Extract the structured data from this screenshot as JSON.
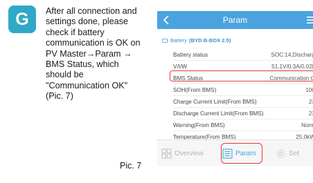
{
  "step": {
    "letter": "G",
    "badge_color": "#2fa9c7"
  },
  "instruction": {
    "text": "After all connection and\nsettings done, please\ncheck if battery\ncommunication is OK on\nPV Master→Param →\nBMS Status, which\nshould be\n\"Communication OK\"\n(Pic. 7)"
  },
  "caption": "Pic. 7",
  "phone": {
    "header_title": "Param",
    "header_color": "#4aa3df",
    "section": {
      "label": "Battery",
      "sub": "(BYD B-BOX 2.5)"
    },
    "rows": [
      {
        "label": "Battery status",
        "value": "SOC:14,Discharg"
      },
      {
        "label": "V/I/W",
        "value": "51.1V/0.3A/0.02k"
      },
      {
        "label": "BMS Status",
        "value": "Communication O"
      },
      {
        "label": "SOH(From BMS)",
        "value": "100"
      },
      {
        "label": "Charge Current Limit(From BMS)",
        "value": "23"
      },
      {
        "label": "Discharge Current Limit(From BMS)",
        "value": "23"
      },
      {
        "label": "Warning(From BMS)",
        "value": "Norm"
      },
      {
        "label": "Temperature(From BMS)",
        "value": "25.0kW"
      }
    ],
    "highlighted_row": "BMS Status",
    "nav": [
      {
        "label": "Overview",
        "icon": "grid-icon",
        "active": false
      },
      {
        "label": "Param",
        "icon": "list-icon",
        "active": true
      },
      {
        "label": "Set",
        "icon": "gear-icon",
        "active": false
      }
    ],
    "highlight_color": "#e23b3b"
  }
}
